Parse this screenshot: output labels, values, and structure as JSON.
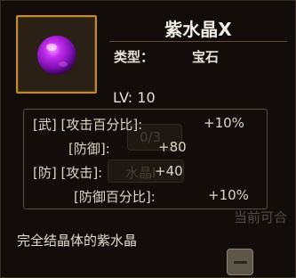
{
  "item": {
    "name": "紫水晶X",
    "type_label": "类型：",
    "type_value": "宝石",
    "level": "LV: 10",
    "description": "完全结晶体的紫水晶"
  },
  "stats": [
    {
      "label": "[武]  [攻击百分比]:",
      "value": "+10%"
    },
    {
      "label": "[防御]:",
      "value": "+80"
    },
    {
      "label": "[防]  [攻击]:",
      "value": "+40"
    },
    {
      "label": "[防御百分比]:",
      "value": "+10%"
    }
  ],
  "background_ghost": {
    "slot_count": "0/3",
    "slot_text": "水晶I",
    "side_text": "当前可合"
  },
  "colors": {
    "frame_border": "#c48a26",
    "gem_color": "#9b1fd0",
    "text": "#e8e2d6"
  },
  "icons": {
    "item_icon": "purple-gem-icon",
    "ghost_button": "minus-button-icon"
  }
}
